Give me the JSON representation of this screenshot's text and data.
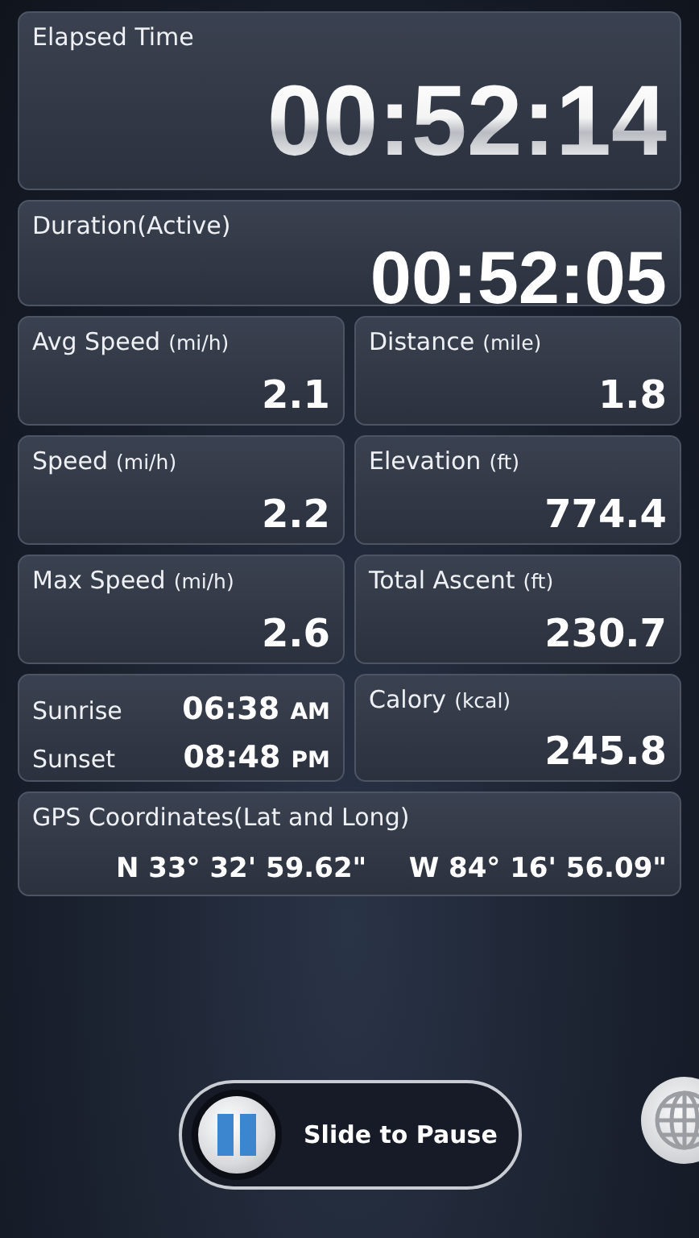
{
  "elapsed": {
    "label": "Elapsed Time",
    "value": "00:52:14"
  },
  "duration": {
    "label": "Duration(Active)",
    "value": "00:52:05"
  },
  "metrics": [
    {
      "kind": "metric",
      "label": "Avg Speed",
      "unit": "(mi/h)",
      "value": "2.1"
    },
    {
      "kind": "metric",
      "label": "Distance",
      "unit": "(mile)",
      "value": "1.8"
    },
    {
      "kind": "metric",
      "label": "Speed",
      "unit": "(mi/h)",
      "value": "2.2"
    },
    {
      "kind": "metric",
      "label": "Elevation",
      "unit": "(ft)",
      "value": "774.4"
    },
    {
      "kind": "metric",
      "label": "Max Speed",
      "unit": "(mi/h)",
      "value": "2.6"
    },
    {
      "kind": "metric",
      "label": "Total Ascent",
      "unit": "(ft)",
      "value": "230.7"
    },
    {
      "kind": "sun",
      "rows": [
        {
          "label": "Sunrise",
          "time": "06:38",
          "meridiem": "AM"
        },
        {
          "label": "Sunset",
          "time": "08:48",
          "meridiem": "PM"
        }
      ]
    },
    {
      "kind": "metric",
      "label": "Calory",
      "unit": "(kcal)",
      "value": "245.8"
    }
  ],
  "gps": {
    "label": "GPS Coordinates(Lat and Long)",
    "lat": "N 33° 32' 59.62\"",
    "long": "W 84° 16' 56.09\""
  },
  "slider": {
    "label": "Slide to Pause",
    "level": 0
  }
}
